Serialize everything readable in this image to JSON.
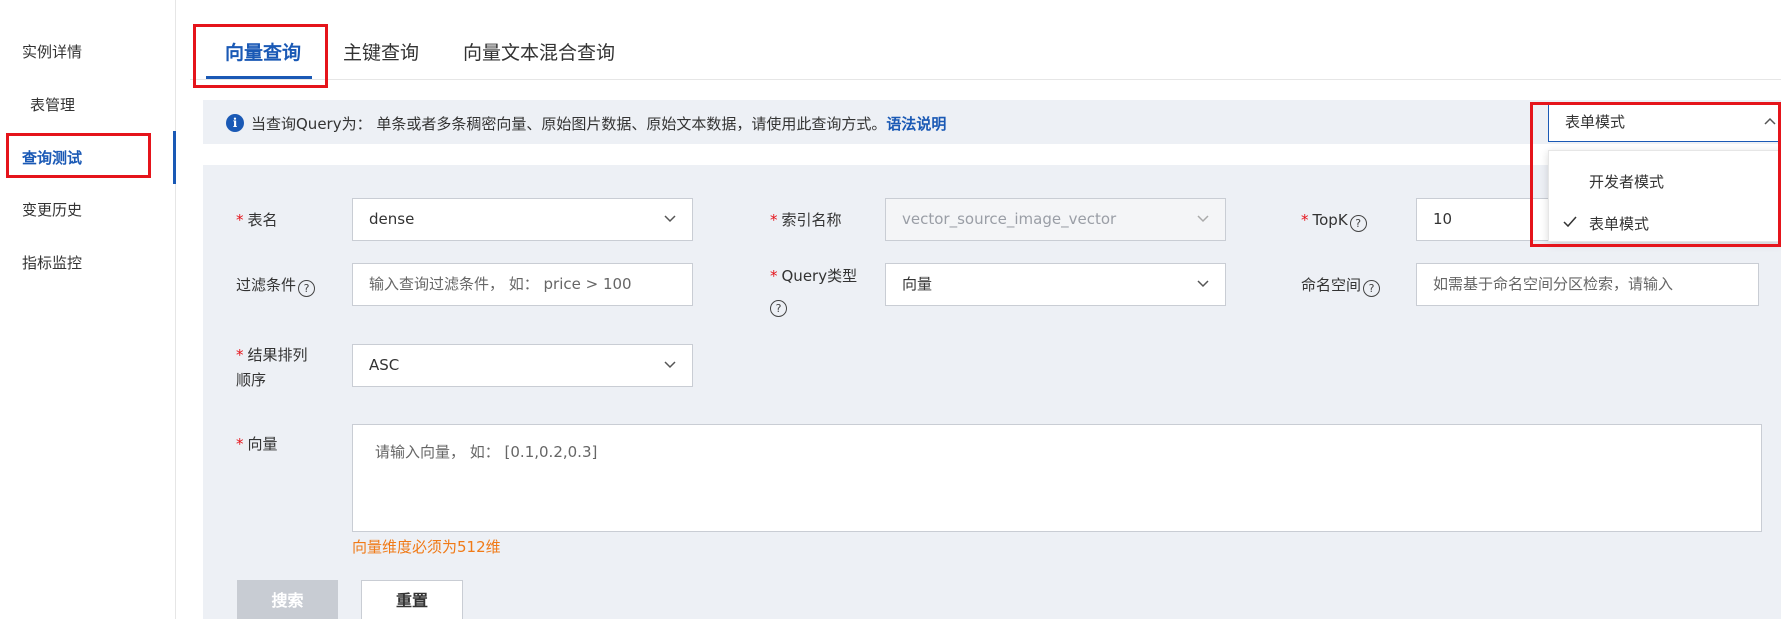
{
  "sidebar": {
    "items": [
      {
        "label": "实例详情"
      },
      {
        "label": "表管理"
      },
      {
        "label": "查询测试"
      },
      {
        "label": "变更历史"
      },
      {
        "label": "指标监控"
      }
    ]
  },
  "tabs": [
    {
      "label": "向量查询"
    },
    {
      "label": "主键查询"
    },
    {
      "label": "向量文本混合查询"
    }
  ],
  "info": {
    "text": "当查询Query为： 单条或者多条稠密向量、原始图片数据、原始文本数据，请使用此查询方式。",
    "link": "语法说明"
  },
  "mode": {
    "selected": "表单模式",
    "options": [
      "开发者模式",
      "表单模式"
    ]
  },
  "form": {
    "table_name": {
      "required": "*",
      "label": "表名",
      "value": "dense"
    },
    "index_name": {
      "required": "*",
      "label": "索引名称",
      "value": "vector_source_image_vector"
    },
    "topk": {
      "required": "*",
      "label": "TopK",
      "value": "10"
    },
    "filter": {
      "label": "过滤条件",
      "placeholder": "输入查询过滤条件， 如： price > 100"
    },
    "query_type": {
      "required": "*",
      "label": "Query类型",
      "value": "向量"
    },
    "namespace": {
      "label": "命名空间",
      "placeholder": "如需基于命名空间分区检索，请输入"
    },
    "sort_order": {
      "required": "*",
      "label_line1": "结果排列",
      "label_line2": "顺序",
      "value": "ASC"
    },
    "vector": {
      "required": "*",
      "label": "向量",
      "placeholder": "请输入向量， 如： [0.1,0.2,0.3]",
      "hint": "向量维度必须为512维"
    }
  },
  "buttons": {
    "search": "搜索",
    "reset": "重置"
  },
  "help_glyph": "?",
  "info_glyph": "i",
  "colors": {
    "accent": "#1a59b5",
    "highlight_box": "#e5141b",
    "hint": "#f07a17",
    "panel_bg": "#edf0f5"
  }
}
